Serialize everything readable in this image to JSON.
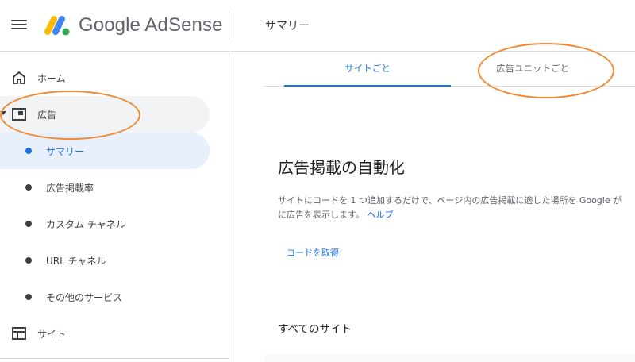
{
  "header": {
    "brand": "Google AdSense",
    "page_title": "サマリー"
  },
  "sidebar": {
    "items": [
      {
        "label": "ホーム",
        "icon": "home-icon"
      },
      {
        "label": "広告",
        "icon": "ad-unit-icon",
        "expanded": true
      },
      {
        "label": "サマリー",
        "selected": true
      },
      {
        "label": "広告掲載率"
      },
      {
        "label": "カスタム チャネル"
      },
      {
        "label": "URL チャネル"
      },
      {
        "label": "その他のサービス"
      },
      {
        "label": "サイト",
        "icon": "site-icon"
      }
    ]
  },
  "main": {
    "tabs": [
      {
        "label": "サイトごと",
        "active": true
      },
      {
        "label": "広告ユニットごと",
        "active": false
      }
    ],
    "section_title": "広告掲載の自動化",
    "description_line1": "サイトにコードを 1 つ追加するだけで、ページ内の広告掲載に適した場所を Google が",
    "description_line2": "に広告を表示します。",
    "help_link": "ヘルプ",
    "get_code_label": "コードを取得",
    "all_sites_title": "すべてのサイト"
  },
  "colors": {
    "accent": "#1a73e8",
    "annotation": "#ef8a32",
    "selected_bg": "#e8f0fe"
  }
}
